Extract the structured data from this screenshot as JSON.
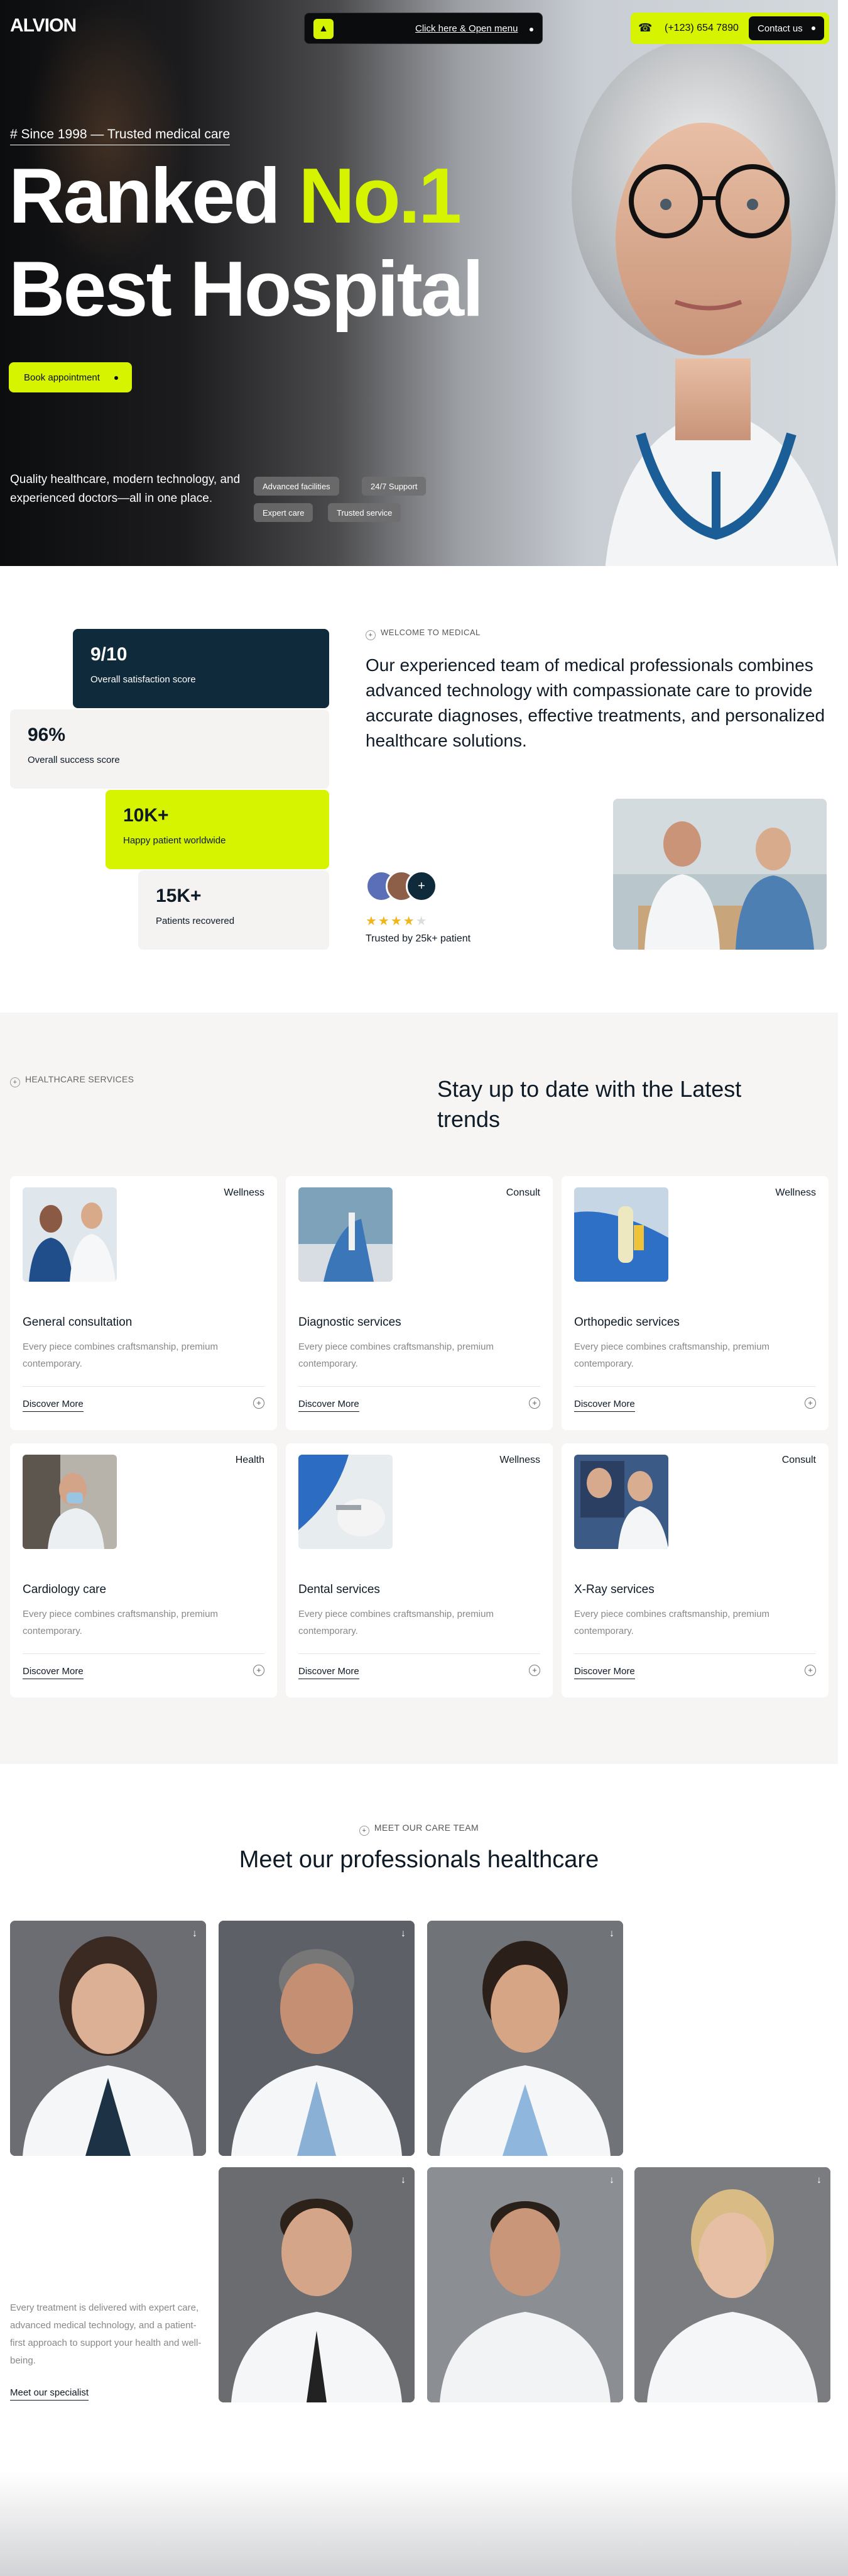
{
  "header": {
    "logo": "ALVION",
    "nav_link": "Click here & Open menu",
    "phone": "(+123) 654 7890",
    "contact_label": "Contact us"
  },
  "hero": {
    "since": "# Since 1998 — Trusted medical care",
    "title_line1_a": "Ranked ",
    "title_line1_b": "No.1",
    "title_line2": "Best Hospital",
    "book_label": "Book appointment",
    "description": "Quality healthcare, modern technology, and experienced doctors—all in one place.",
    "pills": [
      "Advanced facilities",
      "24/7 Support",
      "Expert care",
      "Trusted service"
    ]
  },
  "stats": [
    {
      "value": "9/10",
      "label": "Overall satisfaction score"
    },
    {
      "value": "96%",
      "label": "Overall success score"
    },
    {
      "value": "10K+",
      "label": "Happy patient worldwide"
    },
    {
      "value": "15K+",
      "label": "Patients recovered"
    }
  ],
  "about": {
    "tag": "WELCOME TO MEDICAL",
    "mission": "Our experienced team of medical professionals combines advanced technology with compassionate care to provide accurate diagnoses, effective treatments, and personalized healthcare solutions.",
    "avatar_plus": "+",
    "rating_stars": 4,
    "trusted": "Trusted by 25k+ patient"
  },
  "services": {
    "tag": "HEALTHCARE SERVICES",
    "title": "Stay up to date with the Latest trends",
    "more_label": "Discover More",
    "items": [
      {
        "title": "General consultation",
        "tag": "Wellness",
        "desc": "Every piece combines craftsmanship, premium contemporary."
      },
      {
        "title": "Diagnostic services",
        "tag": "Consult",
        "desc": "Every piece combines craftsmanship, premium contemporary."
      },
      {
        "title": "Orthopedic services",
        "tag": "Wellness",
        "desc": "Every piece combines craftsmanship, premium contemporary."
      },
      {
        "title": "Cardiology care",
        "tag": "Health",
        "desc": "Every piece combines craftsmanship, premium contemporary."
      },
      {
        "title": "Dental services",
        "tag": "Wellness",
        "desc": "Every piece combines craftsmanship, premium contemporary."
      },
      {
        "title": "X-Ray services",
        "tag": "Consult",
        "desc": "Every piece combines craftsmanship, premium contemporary."
      }
    ]
  },
  "team": {
    "tag": "MEET OUR CARE TEAM",
    "title": "Meet our professionals healthcare",
    "text": "Every treatment is delivered with expert care, advanced medical technology, and a patient-first approach to support your health and well-being.",
    "link": "Meet our specialist"
  },
  "colors": {
    "accent": "#d6f400",
    "navy": "#0f2a3a",
    "dark": "#0b0c0e"
  }
}
